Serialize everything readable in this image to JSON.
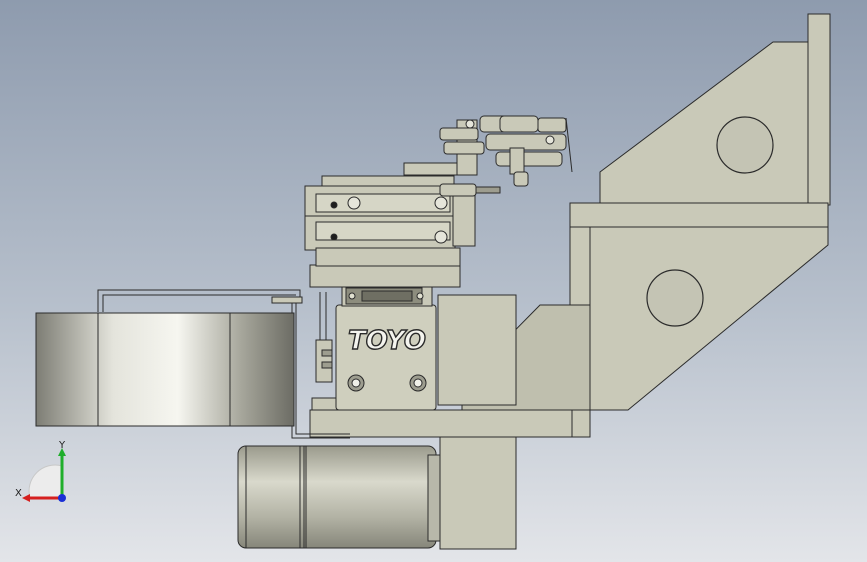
{
  "viewport": {
    "part_brand_label": "TOYO"
  },
  "triad": {
    "x_label": "X",
    "y_label": "Y",
    "colors": {
      "x": "#d6201f",
      "y": "#1fae2b",
      "z": "#1a2fd6"
    }
  },
  "colors": {
    "part_fill": "#c9c9b8",
    "part_edge": "#2b2b2b",
    "shadow_fill": "#a9a99a"
  }
}
